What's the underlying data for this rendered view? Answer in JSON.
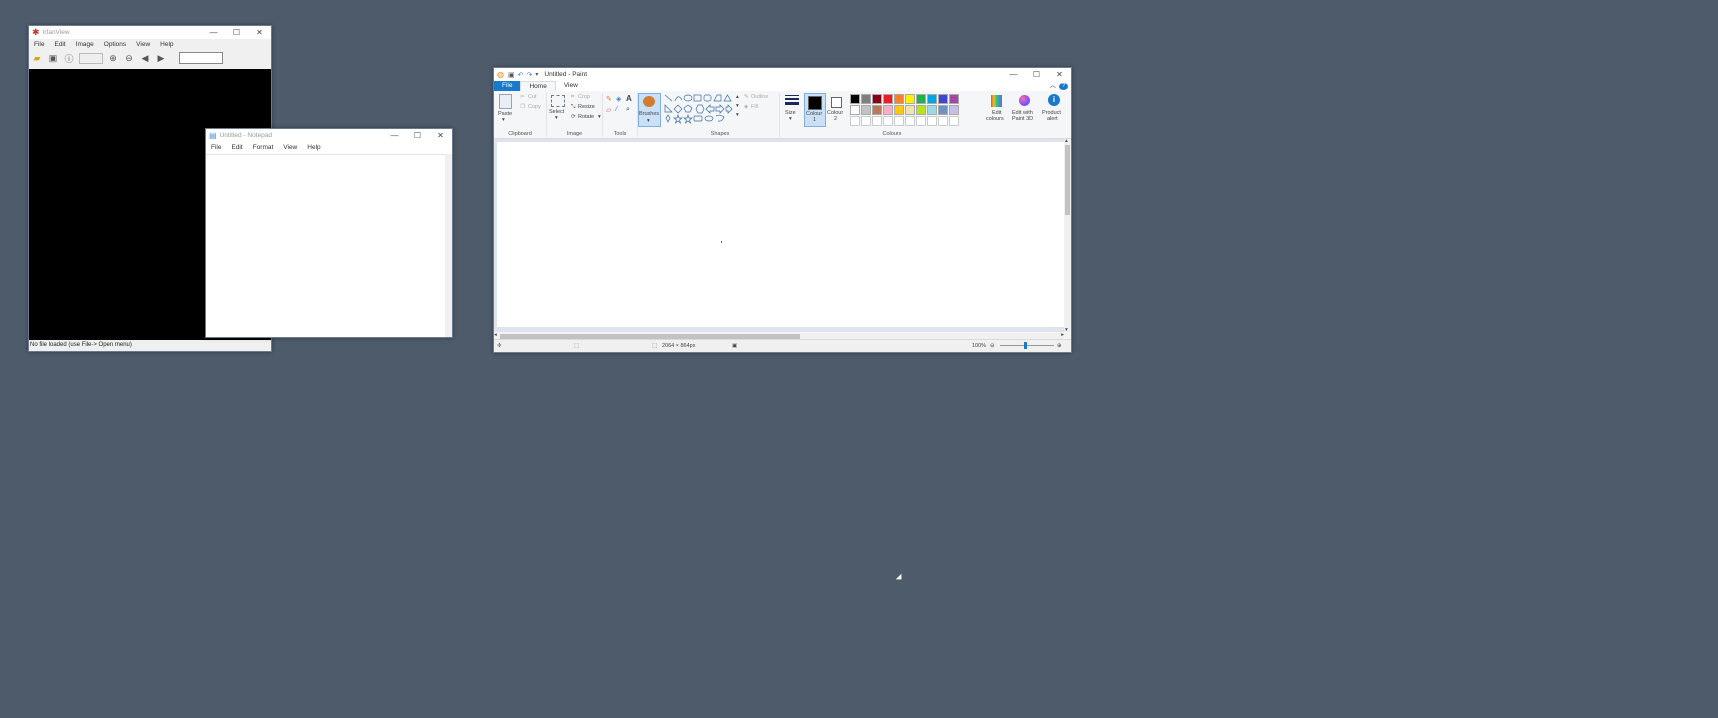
{
  "irfanview": {
    "title": "IrfanView",
    "menu": [
      "File",
      "Edit",
      "Image",
      "Options",
      "View",
      "Help"
    ],
    "status": "No file loaded (use File-> Open menu)"
  },
  "notepad": {
    "title": "Untitled - Notepad",
    "menu": [
      "File",
      "Edit",
      "Format",
      "View",
      "Help"
    ]
  },
  "paint": {
    "title": "Untitled - Paint",
    "tabs": {
      "file": "File",
      "home": "Home",
      "view": "View"
    },
    "clipboard": {
      "paste": "Paste",
      "cut": "Cut",
      "copy": "Copy",
      "label": "Clipboard"
    },
    "image": {
      "select": "Select",
      "crop": "Crop",
      "resize": "Resize",
      "rotate": "Rotate",
      "label": "Image"
    },
    "tools": {
      "label": "Tools",
      "brushes": "Brushes"
    },
    "shapes": {
      "outline": "Outline",
      "fill": "Fill",
      "label": "Shapes"
    },
    "size": {
      "label": "Size"
    },
    "colour1": {
      "label1": "Colour",
      "label2": "1"
    },
    "colour2": {
      "label1": "Colour",
      "label2": "2"
    },
    "colours": {
      "label": "Colours",
      "palette_row1": [
        "#000000",
        "#7f7f7f",
        "#880015",
        "#ed1c24",
        "#ff7f27",
        "#fff200",
        "#22b14c",
        "#00a2e8",
        "#3f48cc",
        "#a349a4"
      ],
      "palette_row2": [
        "#ffffff",
        "#c3c3c3",
        "#b97a57",
        "#ffaec9",
        "#ffc90e",
        "#efe4b0",
        "#b5e61d",
        "#99d9ea",
        "#7092be",
        "#c8bfe7"
      ]
    },
    "edit_colours": {
      "l1": "Edit",
      "l2": "colours"
    },
    "paint3d": {
      "l1": "Edit with",
      "l2": "Paint 3D"
    },
    "product_alert": {
      "l1": "Product",
      "l2": "alert"
    },
    "status": {
      "dimensions": "2064 × 864px",
      "zoom": "100%"
    }
  }
}
